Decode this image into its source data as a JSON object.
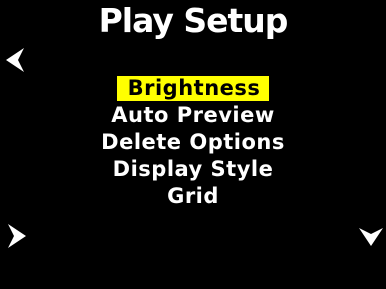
{
  "header": {
    "title": "Play Setup"
  },
  "menu": {
    "items": [
      {
        "label": "Brightness",
        "selected": true
      },
      {
        "label": "Auto Preview",
        "selected": false
      },
      {
        "label": "Delete Options",
        "selected": false
      },
      {
        "label": "Display Style",
        "selected": false
      },
      {
        "label": "Grid",
        "selected": false
      }
    ]
  },
  "icons": {
    "left": "chevron-left-icon",
    "right": "chevron-right-icon",
    "down": "chevron-down-icon"
  },
  "colors": {
    "background": "#000000",
    "text": "#ffffff",
    "highlight": "#ffff00",
    "highlight_text": "#000000"
  }
}
